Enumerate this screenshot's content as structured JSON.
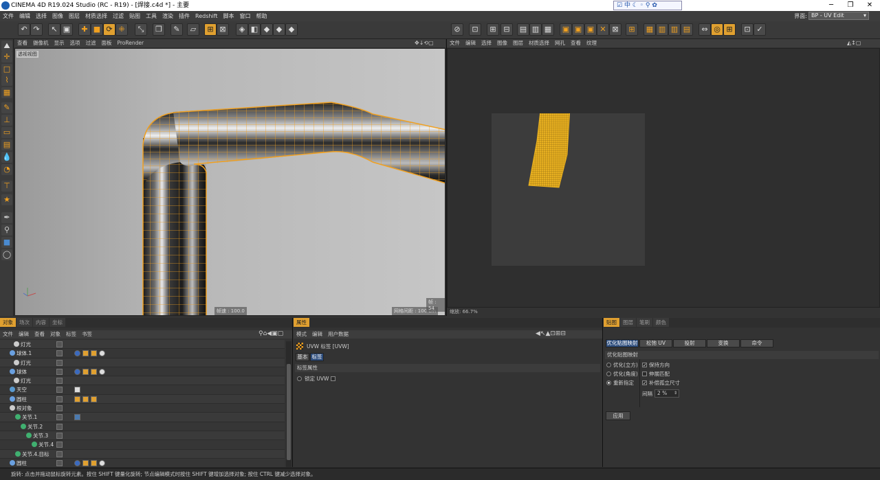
{
  "title_bar": {
    "text": "CINEMA 4D R19.024 Studio (RC - R19) - [焊接.c4d *] - 主要",
    "min": "─",
    "max": "❐",
    "close": "✕"
  },
  "ime_bar": {
    "lang": "中"
  },
  "menu": [
    "文件",
    "编辑",
    "选择",
    "图像",
    "图层",
    "材质选择",
    "过滤",
    "贴图",
    "工具",
    "渲染",
    "插件",
    "Redshift",
    "脚本",
    "窗口",
    "帮助"
  ],
  "layout": {
    "label": "界面:",
    "value": "BP - UV Edit"
  },
  "viewport": {
    "menu": [
      "查看",
      "摄像机",
      "显示",
      "选项",
      "过滤",
      "面板",
      "ProRender"
    ],
    "label": "透视视图",
    "speed": "帧速 : 100.0",
    "grid": "网格间距 : 100 cm",
    "frame": "帧 : 54"
  },
  "uv_editor": {
    "menu": [
      "文件",
      "编辑",
      "选择",
      "图像",
      "图层",
      "材质选择",
      "网孔",
      "查看",
      "纹理"
    ],
    "zoom": "缩放: 66.7%"
  },
  "objects_panel": {
    "tabs": [
      "对象",
      "场次",
      "内容",
      "坐标"
    ],
    "menu": [
      "文件",
      "编辑",
      "查看",
      "对象",
      "标签",
      "书签"
    ],
    "rows": [
      {
        "name": "灯光",
        "indent": 30
      },
      {
        "name": "球体.1",
        "indent": 24
      },
      {
        "name": "灯光",
        "indent": 30
      },
      {
        "name": "球体",
        "indent": 24
      },
      {
        "name": "灯光",
        "indent": 30
      },
      {
        "name": "天空",
        "indent": 24
      },
      {
        "name": "圆柱",
        "indent": 24
      },
      {
        "name": "根对象",
        "indent": 24
      },
      {
        "name": "关节.1",
        "indent": 32
      },
      {
        "name": "关节.2",
        "indent": 40
      },
      {
        "name": "关节.3",
        "indent": 48
      },
      {
        "name": "关节.4",
        "indent": 56
      },
      {
        "name": "关节.4.目标",
        "indent": 32
      },
      {
        "name": "圆柱",
        "indent": 24
      }
    ]
  },
  "attributes_panel": {
    "tabs": [
      "属性"
    ],
    "menu": [
      "模式",
      "编辑",
      "用户数据"
    ],
    "tag_title": "UVW 标签 [UVW]",
    "subtabs": [
      "基本",
      "标签"
    ],
    "section": "标签属性",
    "lock_uvw": "锁定 UVW"
  },
  "uv_tools": {
    "tabs": [
      "贴图",
      "图层",
      "笔刷",
      "颜色"
    ],
    "buttons": [
      "优化贴图映射",
      "松弛 UV",
      "投射",
      "变换",
      "命令"
    ],
    "section": "优化贴图映射",
    "options": [
      "优化(立方)",
      "优化(角度)",
      "重新指定"
    ],
    "checks": [
      "保持方向",
      "伸展匹配",
      "补偿孤立尺寸"
    ],
    "spacing_label": "间隔",
    "spacing_value": "2 %",
    "apply": "应用"
  },
  "status": "旋转: 点击并拖动鼠标旋转元素。按住 SHIFT 键量化旋转; 节点编辑模式时按住 SHIFT 键增加选择对象; 按住 CTRL 键减少选择对象。",
  "clock": "1:23:19",
  "colors": {
    "accent": "#e0a030",
    "wire": "#f0a020",
    "uvblock": "#e8b020"
  }
}
